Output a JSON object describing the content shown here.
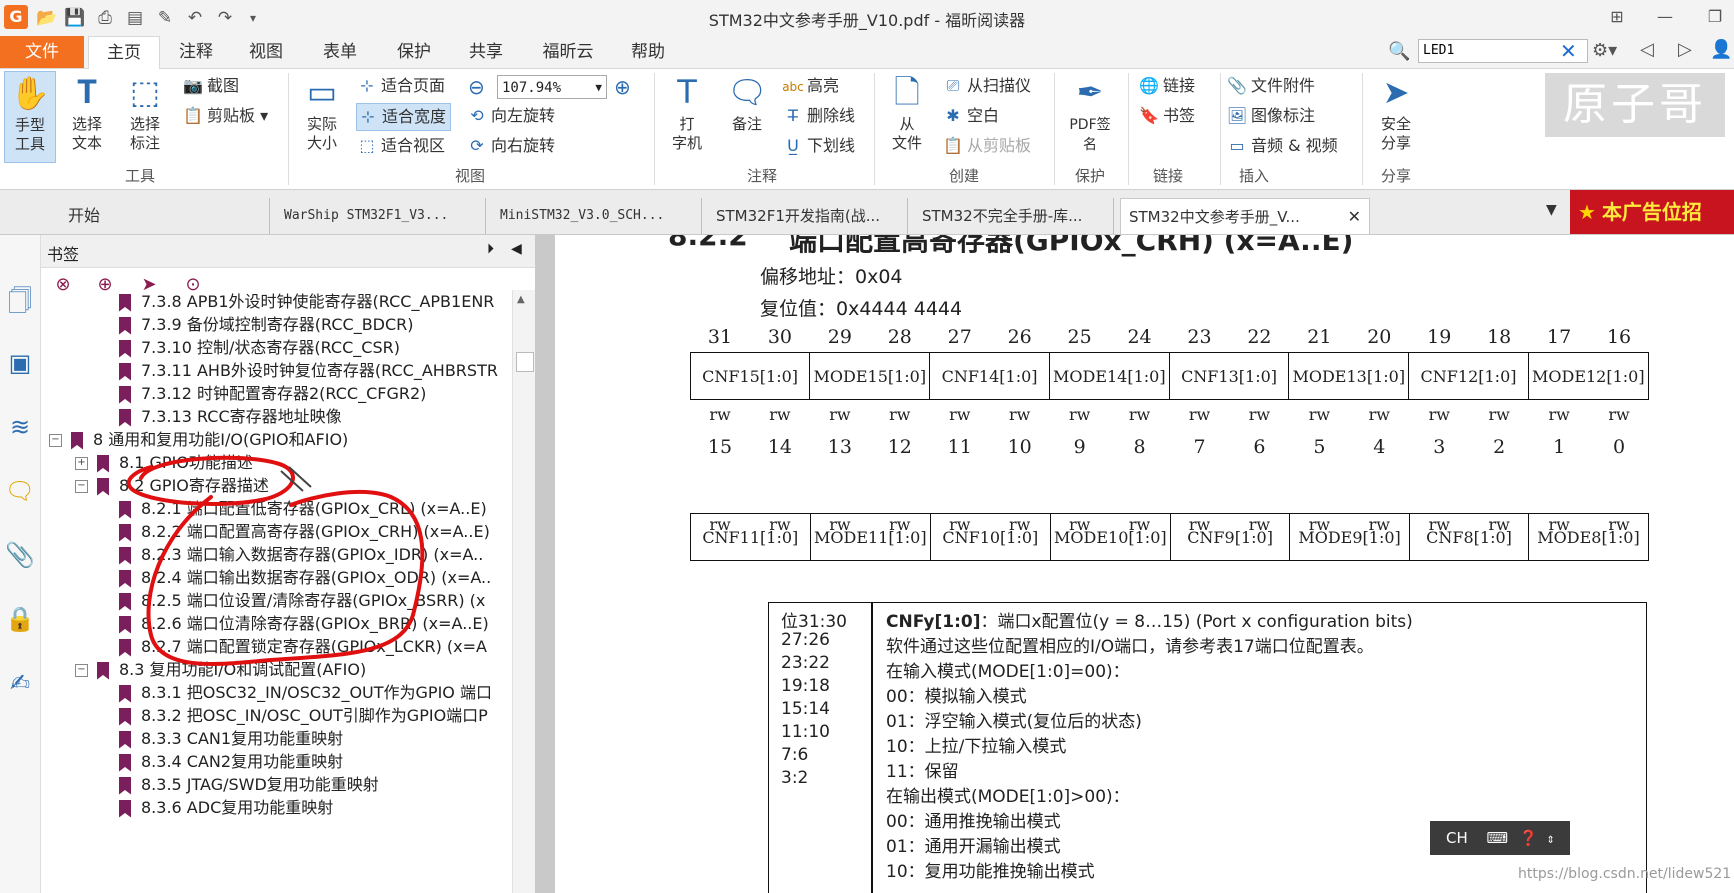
{
  "window": {
    "title": "STM32中文参考手册_V10.pdf - 福昕阅读器"
  },
  "menu": {
    "tabs": [
      "文件",
      "主页",
      "注释",
      "视图",
      "表单",
      "保护",
      "共享",
      "福昕云",
      "帮助"
    ],
    "active": "主页",
    "search_value": "LED1"
  },
  "ribbon": {
    "tools": {
      "hand": "手型\n工具",
      "select_text": "选择\n文本",
      "select_annot": "选择\n标注",
      "screenshot": "截图",
      "clipboard": "剪贴板",
      "group": "工具"
    },
    "view": {
      "actual_size": "实际\n大小",
      "fit_page": "适合页面",
      "fit_width": "适合宽度",
      "fit_visible": "适合视区",
      "zoom": "107.94%",
      "rotate_left": "向左旋转",
      "rotate_right": "向右旋转",
      "group": "视图"
    },
    "comment": {
      "typewriter": "打\n字机",
      "note": "备注",
      "highlight": "高亮",
      "strikeout": "删除线",
      "underline": "下划线",
      "group": "注释"
    },
    "create": {
      "from_file": "从\n文件",
      "from_scanner": "从扫描仪",
      "blank": "空白",
      "from_clipboard": "从剪贴板",
      "group": "创建"
    },
    "protect": {
      "pdf_sign": "PDF签\n名",
      "group": "保护"
    },
    "links": {
      "link": "链接",
      "bookmark": "书签",
      "group": "链接"
    },
    "insert": {
      "attachment": "文件附件",
      "image_annot": "图像标注",
      "audio_video": "音频 & 视频",
      "group": "插入"
    },
    "share": {
      "secure_share": "安全\n分享",
      "group": "分享"
    },
    "logo": "原子哥"
  },
  "doc_tabs": [
    "开始",
    "WarShip STM32F1_V3...",
    "MiniSTM32_V3.0_SCH...",
    "STM32F1开发指南(战...",
    "STM32不完全手册-库...",
    "STM32中文参考手册_V..."
  ],
  "ad_banner": "本广告位招",
  "bookmarks": {
    "title": "书签",
    "items": [
      {
        "text": "7.3.8 APB1外设时钟使能寄存器(RCC_APB1ENR",
        "level": 2
      },
      {
        "text": "7.3.9 备份域控制寄存器(RCC_BDCR)",
        "level": 2
      },
      {
        "text": "7.3.10 控制/状态寄存器(RCC_CSR)",
        "level": 2
      },
      {
        "text": "7.3.11 AHB外设时钟复位寄存器(RCC_AHBRSTR",
        "level": 2
      },
      {
        "text": "7.3.12 时钟配置寄存器2(RCC_CFGR2)",
        "level": 2
      },
      {
        "text": "7.3.13 RCC寄存器地址映像",
        "level": 2
      },
      {
        "text": "8 通用和复用功能I/O(GPIO和AFIO)",
        "level": 0
      },
      {
        "text": "8.1 GPIO功能描述",
        "level": 1
      },
      {
        "text": "8.2 GPIO寄存器描述",
        "level": 1
      },
      {
        "text": "8.2.1 端口配置低寄存器(GPIOx_CRL) (x=A..E)",
        "level": 2
      },
      {
        "text": "8.2.2 端口配置高寄存器(GPIOx_CRH) (x=A..E)",
        "level": 2
      },
      {
        "text": "8.2.3 端口输入数据寄存器(GPIOx_IDR) (x=A..",
        "level": 2
      },
      {
        "text": "8.2.4 端口输出数据寄存器(GPIOx_ODR) (x=A..",
        "level": 2
      },
      {
        "text": "8.2.5 端口位设置/清除寄存器(GPIOx_BSRR) (x",
        "level": 2
      },
      {
        "text": "8.2.6 端口位清除寄存器(GPIOx_BRR) (x=A..E)",
        "level": 2
      },
      {
        "text": "8.2.7 端口配置锁定寄存器(GPIOx_LCKR) (x=A",
        "level": 2
      },
      {
        "text": "8.3 复用功能I/O和调试配置(AFIO)",
        "level": 1
      },
      {
        "text": "8.3.1 把OSC32_IN/OSC32_OUT作为GPIO 端口",
        "level": 2
      },
      {
        "text": "8.3.2 把OSC_IN/OSC_OUT引脚作为GPIO端口P",
        "level": 2
      },
      {
        "text": "8.3.3 CAN1复用功能重映射",
        "level": 2
      },
      {
        "text": "8.3.4 CAN2复用功能重映射",
        "level": 2
      },
      {
        "text": "8.3.5 JTAG/SWD复用功能重映射",
        "level": 2
      },
      {
        "text": "8.3.6 ADC复用功能重映射",
        "level": 2
      }
    ]
  },
  "document": {
    "section_num": "8.2.2",
    "section_title": "端口配置高寄存器(GPIOx_CRH) (x=A..E)",
    "offset": "偏移地址：0x04",
    "reset": "复位值：0x4444 4444",
    "bits_high": [
      "31",
      "30",
      "29",
      "28",
      "27",
      "26",
      "25",
      "24",
      "23",
      "22",
      "21",
      "20",
      "19",
      "18",
      "17",
      "16"
    ],
    "fields_high": [
      "CNF15[1:0]",
      "MODE15[1:0]",
      "CNF14[1:0]",
      "MODE14[1:0]",
      "CNF13[1:0]",
      "MODE13[1:0]",
      "CNF12[1:0]",
      "MODE12[1:0]"
    ],
    "bits_low": [
      "15",
      "14",
      "13",
      "12",
      "11",
      "10",
      "9",
      "8",
      "7",
      "6",
      "5",
      "4",
      "3",
      "2",
      "1",
      "0"
    ],
    "fields_low": [
      "CNF11[1:0]",
      "MODE11[1:0]",
      "CNF10[1:0]",
      "MODE10[1:0]",
      "CNF9[1:0]",
      "MODE9[1:0]",
      "CNF8[1:0]",
      "MODE8[1:0]"
    ],
    "access": "rw",
    "bit_ranges": [
      "位31:30",
      "27:26",
      "23:22",
      "19:18",
      "15:14",
      "11:10",
      "7:6",
      "3:2"
    ],
    "desc_title_bold": "CNFy[1:0]",
    "desc_title_rest": "：端口x配置位(y = 8…15) (Port x configuration bits)",
    "desc_lines": [
      "软件通过这些位配置相应的I/O端口，请参考表17端口位配置表。",
      "在输入模式(MODE[1:0]=00)：",
      "00：模拟输入模式",
      "01：浮空输入模式(复位后的状态)",
      "10：上拉/下拉输入模式",
      "11：保留",
      "在输出模式(MODE[1:0]>00)：",
      "00：通用推挽输出模式",
      "01：通用开漏输出模式",
      "10：复用功能推挽输出模式"
    ]
  },
  "ime": "CH",
  "watermark": "https://blog.csdn.net/lidew521",
  "colors": {
    "accent": "#f37021",
    "bookmark_flag": "#7a1f5c",
    "annotation_red": "#e01010"
  }
}
